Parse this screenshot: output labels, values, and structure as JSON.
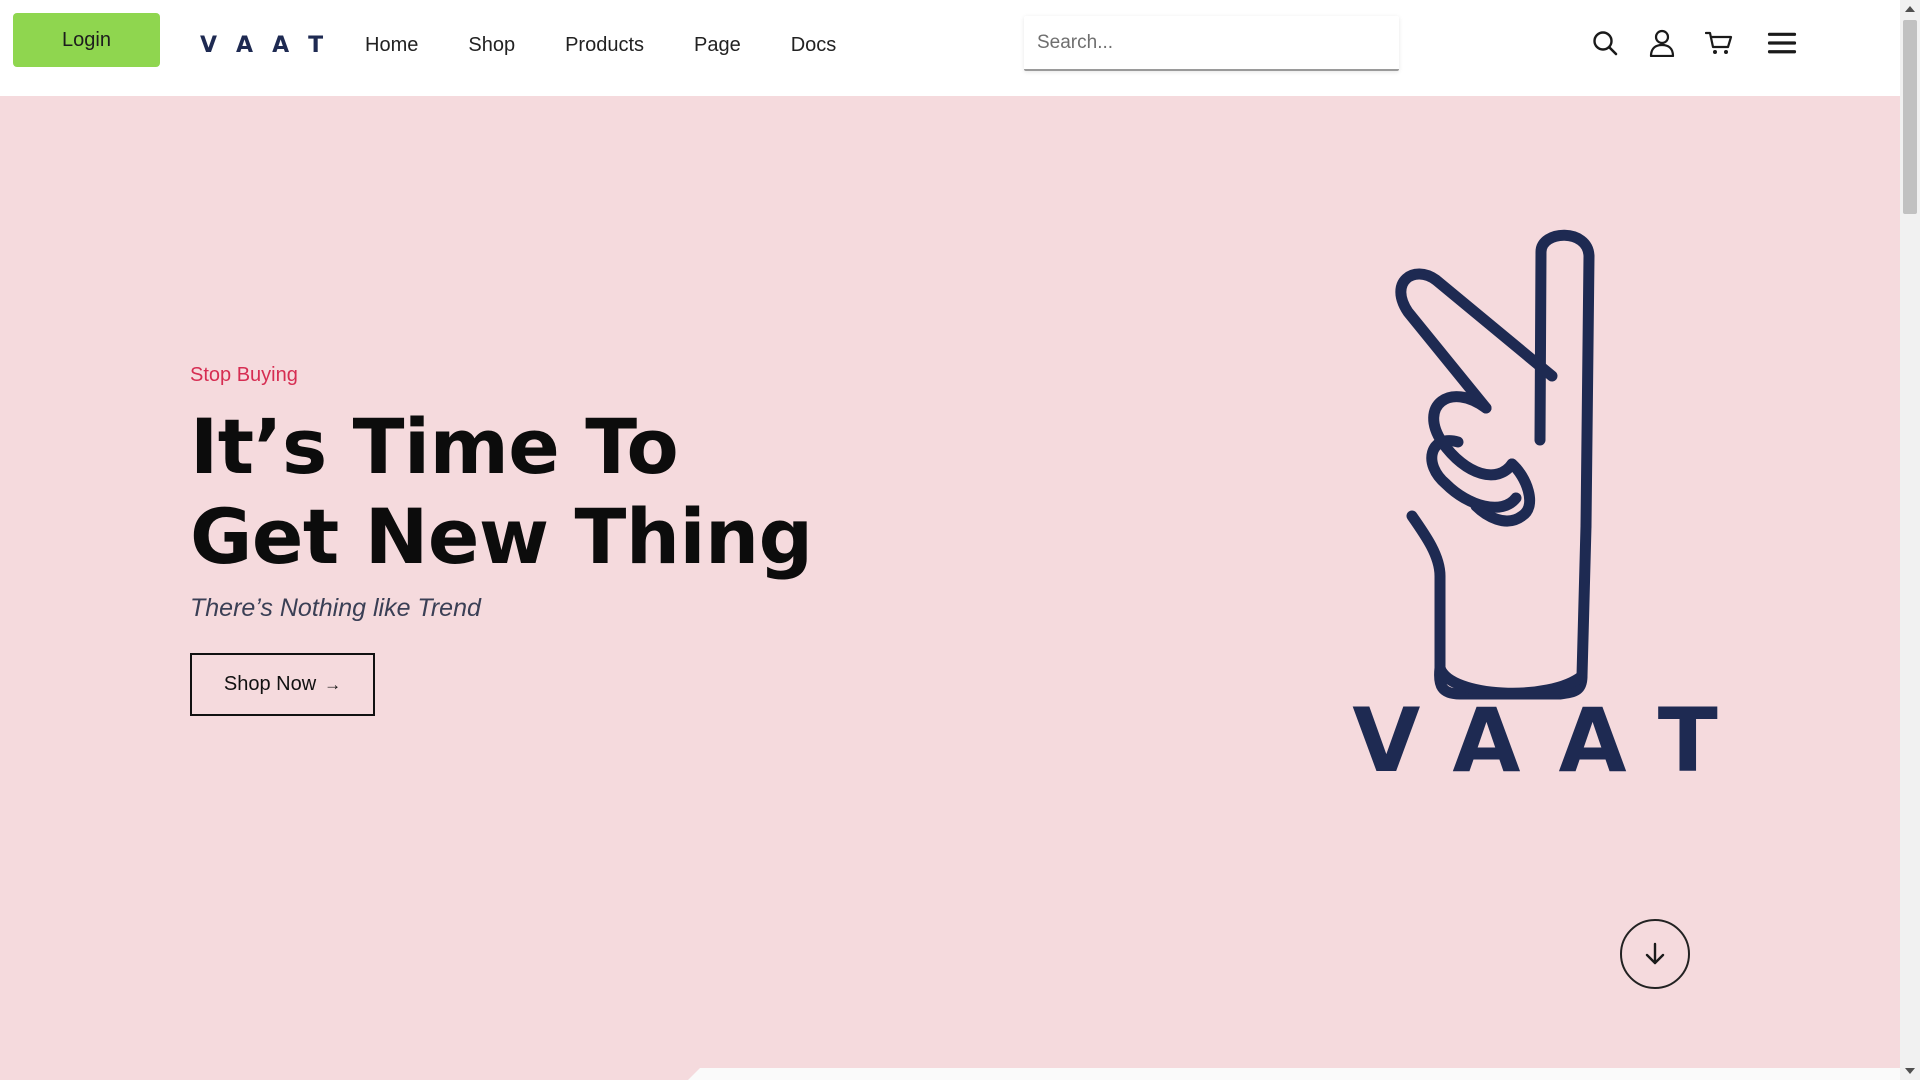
{
  "header": {
    "login_label": "Login",
    "logo_letters": [
      "V",
      "A",
      "A",
      "T"
    ],
    "nav": [
      {
        "label": "Home"
      },
      {
        "label": "Shop"
      },
      {
        "label": "Products"
      },
      {
        "label": "Page"
      },
      {
        "label": "Docs"
      }
    ],
    "search": {
      "placeholder": "Search...",
      "value": ""
    },
    "icons": [
      "search-icon",
      "user-icon",
      "cart-icon",
      "menu-icon"
    ]
  },
  "hero": {
    "eyebrow": "Stop Buying",
    "headline_line1": "It’s Time To",
    "headline_line2": "Get New Thing",
    "subline": "There’s Nothing like Trend",
    "cta_label": "Shop Now",
    "cta_arrow": "→",
    "brand_wordmark": "VAAT",
    "scroll_down_icon": "arrow-down-icon"
  },
  "colors": {
    "login_bg": "#8fd64f",
    "hero_bg": "#f5dadd",
    "eyebrow": "#d62d52",
    "brand_navy": "#1e2a52"
  }
}
